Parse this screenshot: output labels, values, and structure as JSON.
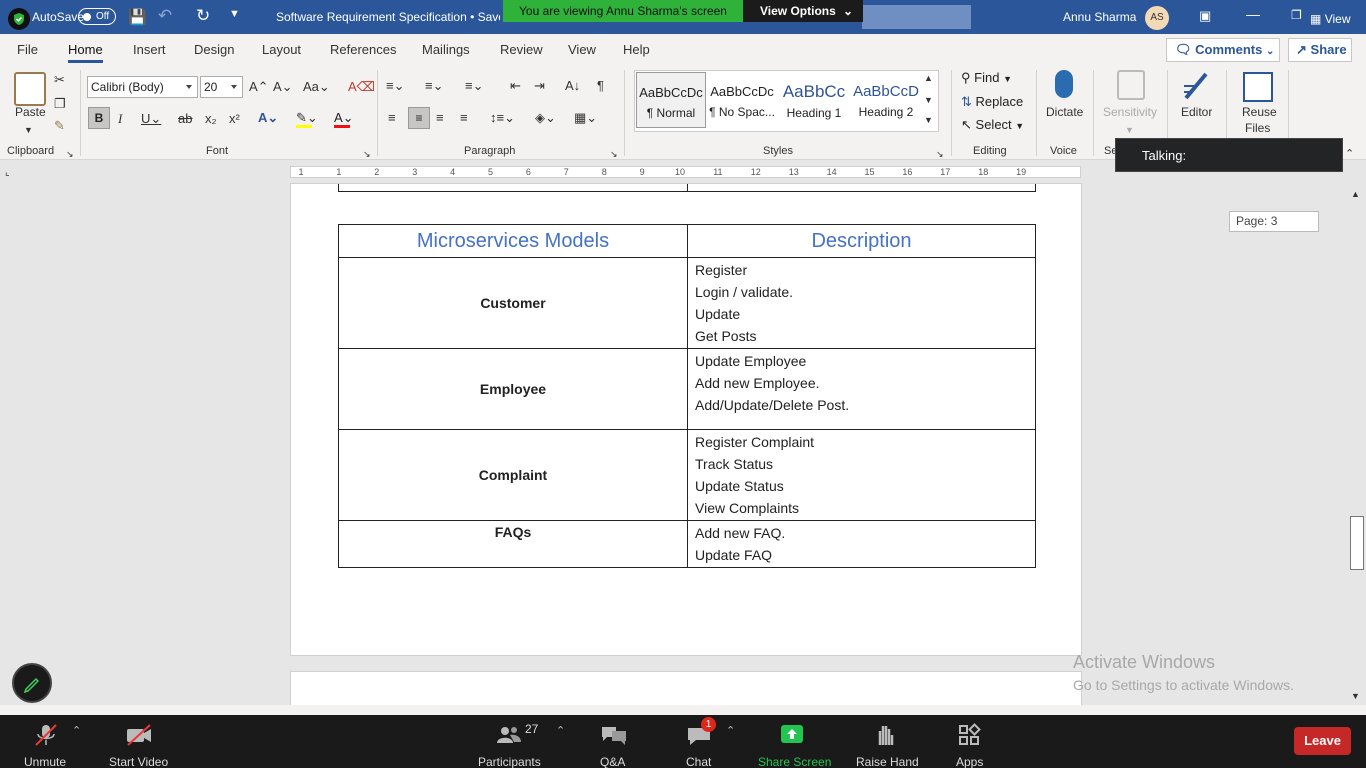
{
  "titlebar": {
    "autosave_label": "AutoSave",
    "autosave_state": "Off",
    "doc_title": "Software Requirement Specification • Saved",
    "user_name": "Annu Sharma",
    "user_initials": "AS",
    "view_label": "View"
  },
  "screen_share": {
    "banner": "You are viewing Annu Sharma's screen",
    "view_options": "View Options"
  },
  "tabs": [
    "File",
    "Home",
    "Insert",
    "Design",
    "Layout",
    "References",
    "Mailings",
    "Review",
    "View",
    "Help"
  ],
  "active_tab": "Home",
  "header_buttons": {
    "comments": "Comments",
    "share": "Share"
  },
  "ribbon": {
    "clipboard": {
      "paste": "Paste",
      "label": "Clipboard"
    },
    "font": {
      "name": "Calibri (Body)",
      "size": "20",
      "label": "Font"
    },
    "paragraph": {
      "label": "Paragraph"
    },
    "styles": {
      "label": "Styles",
      "items": [
        {
          "sample": "AaBbCcDc",
          "name": "¶ Normal"
        },
        {
          "sample": "AaBbCcDc",
          "name": "¶ No Spac..."
        },
        {
          "sample": "AaBbCc",
          "name": "Heading 1"
        },
        {
          "sample": "AaBbCcD",
          "name": "Heading 2"
        }
      ]
    },
    "editing": {
      "find": "Find",
      "replace": "Replace",
      "select": "Select",
      "label": "Editing"
    },
    "voice": {
      "dictate": "Dictate",
      "label": "Voice"
    },
    "sensitivity": {
      "label": "Sensitivity",
      "group": "Se"
    },
    "editor": {
      "label": "Editor"
    },
    "reuse": {
      "label_line1": "Reuse",
      "label_line2": "Files"
    }
  },
  "ruler": {
    "marks": [
      "1",
      "1",
      "2",
      "3",
      "4",
      "5",
      "6",
      "7",
      "8",
      "9",
      "10",
      "11",
      "12",
      "13",
      "14",
      "15",
      "16",
      "17",
      "18",
      "19"
    ]
  },
  "document": {
    "table": {
      "headers": [
        "Microservices Models",
        "Description"
      ],
      "rows": [
        {
          "model": "Customer",
          "items": [
            "Register",
            "Login / validate.",
            "Update",
            "Get Posts"
          ]
        },
        {
          "model": "Employee",
          "items": [
            "Update Employee",
            "Add new Employee.",
            "Add/Update/Delete Post."
          ]
        },
        {
          "model": "Complaint",
          "items": [
            "Register Complaint",
            "Track Status",
            "Update Status",
            "View Complaints"
          ]
        },
        {
          "model": "FAQs",
          "items": [
            "Add new FAQ.",
            "Update FAQ"
          ]
        }
      ]
    },
    "page_indicator": "Page: 3"
  },
  "overlay": {
    "talking": "Talking:"
  },
  "watermark": {
    "line1": "Activate Windows",
    "line2": "Go to Settings to activate Windows."
  },
  "zoom_controls": {
    "unmute": "Unmute",
    "start_video": "Start Video",
    "participants": "Participants",
    "participants_count": "27",
    "qa": "Q&A",
    "chat": "Chat",
    "chat_badge": "1",
    "share_screen": "Share Screen",
    "raise_hand": "Raise Hand",
    "apps": "Apps",
    "leave": "Leave"
  },
  "colors": {
    "word_blue": "#2b579a",
    "heading_blue": "#4472c4",
    "share_green": "#2eb23a",
    "leave_red": "#c62828"
  }
}
